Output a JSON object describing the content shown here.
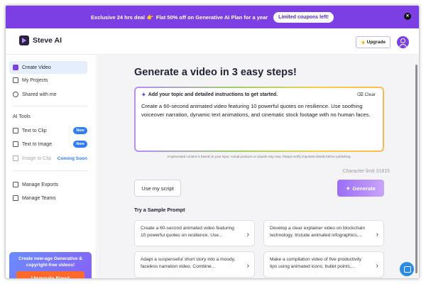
{
  "promo_bar": {
    "deal_prefix": "Exclusive 24 hrs deal",
    "deal_emoji": "👉",
    "deal_text": "Flat 50% off on Generative AI Plan for a year",
    "coupon_label": "Limited coupons left!",
    "close_icon": "close-icon",
    "bg_color": "#7b3fe4"
  },
  "header": {
    "logo_text": "Steve AI",
    "upgrade_label": "Upgrade",
    "upgrade_icon": "star-icon",
    "avatar_icon": "user-icon"
  },
  "sidebar": {
    "items_top": [
      {
        "label": "Create Video",
        "icon": "video-icon",
        "active": true
      },
      {
        "label": "My Projects",
        "icon": "folder-icon"
      },
      {
        "label": "Shared with me",
        "icon": "shared-icon"
      }
    ],
    "ai_tools_label": "AI Tools",
    "ai_tools": [
      {
        "label": "Text to Clip",
        "badge": "New"
      },
      {
        "label": "Text to Image",
        "badge": "New"
      },
      {
        "label": "Image to Clip",
        "badge": "Coming Soon"
      }
    ],
    "items_bottom": [
      {
        "label": "Manage Exports"
      },
      {
        "label": "Manage Teams"
      }
    ],
    "promo_card": {
      "text": "Create new-age Generative & copyright-free videos!",
      "button_label": "Upgrade Now!"
    }
  },
  "main": {
    "title": "Generate a video in 3 easy steps!",
    "prompt": {
      "header": "Add your topic and detailed instructions to get started.",
      "clear_label": "Clear",
      "text": "Create a 60-second animated video featuring 10 powerful quotes on resilience. Use soothing voiceover narration, dynamic text animations, and cinematic stock footage with no human faces."
    },
    "disclaimer": "AI-generated content is based on your input. Actual products or visuals may vary. Always verify important details before publishing.",
    "character_limit": "Character limit 31815",
    "my_script_label": "Use my script",
    "generate_label": "Generate",
    "sample_title": "Try a Sample Prompt",
    "samples": [
      {
        "text": "Create a 60-second animated video featuring 10 powerful quotes on resilience. Use..."
      },
      {
        "text": "Develop a clear explainer video on blockchain technology. Include animated infographics,..."
      },
      {
        "text": "Adapt a suspenseful short story into a moody, faceless narration video. Combine..."
      },
      {
        "text": "Make a compilation video of five productivity tips using animated icons, bullet points,..."
      }
    ]
  }
}
